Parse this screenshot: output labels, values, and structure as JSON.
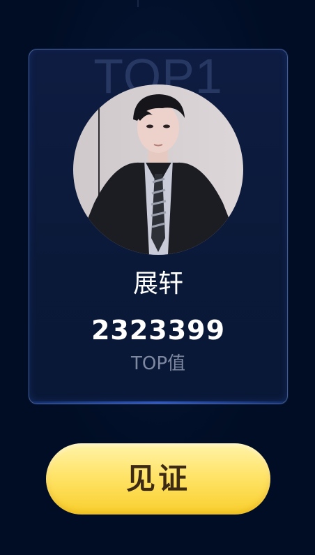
{
  "card": {
    "rank_label": "TOP1",
    "avatar_alt": "展轩",
    "name": "展轩",
    "score": "2323399",
    "score_label": "TOP值"
  },
  "action": {
    "button_label": "见证"
  },
  "colors": {
    "background": "#000d24",
    "card_background": "#0b1939",
    "button_yellow": "#ffe46a",
    "button_text": "#3d2a14"
  }
}
